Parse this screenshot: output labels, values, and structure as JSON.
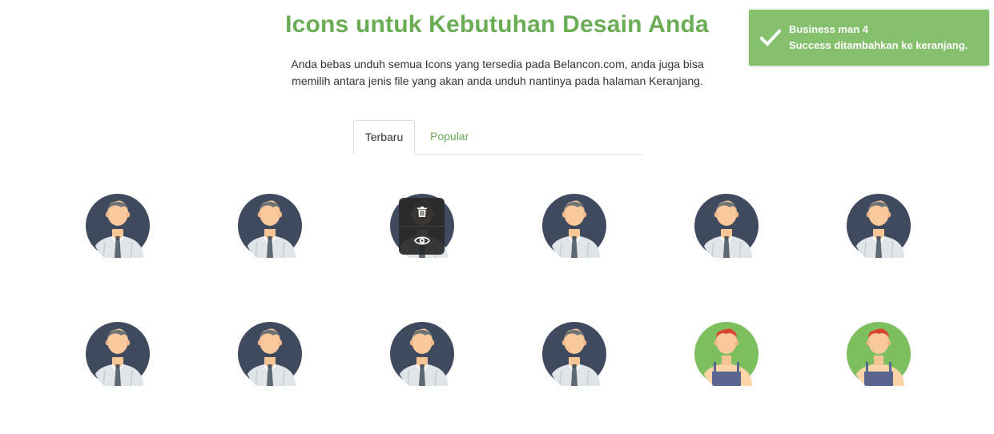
{
  "header": {
    "title": "Icons untuk Kebutuhan Desain Anda",
    "description_line1": "Anda bebas unduh semua Icons yang tersedia pada Belancon.com, anda juga bisa",
    "description_line2": "memilih antara jenis file yang akan anda unduh nantinya pada halaman Keranjang."
  },
  "tabs": [
    {
      "label": "Terbaru",
      "active": true
    },
    {
      "label": "Popular",
      "active": false
    }
  ],
  "icons": [
    {
      "type": "business-man"
    },
    {
      "type": "business-man"
    },
    {
      "type": "business-man"
    },
    {
      "type": "business-man"
    },
    {
      "type": "business-man"
    },
    {
      "type": "business-man"
    },
    {
      "type": "business-man"
    },
    {
      "type": "business-man"
    },
    {
      "type": "business-man"
    },
    {
      "type": "business-man"
    },
    {
      "type": "worker"
    },
    {
      "type": "worker"
    }
  ],
  "hover_menu": {
    "actions": [
      "trash-icon",
      "eye-icon"
    ]
  },
  "toast": {
    "title": "Business man 4",
    "message": "Success ditambahkan ke keranjang.",
    "icon": "check-icon"
  },
  "colors": {
    "accent": "#6aad55",
    "toast_bg": "#85c06c",
    "businessman_bg": "#3f4a5f",
    "worker_bg": "#7dbf5e"
  }
}
